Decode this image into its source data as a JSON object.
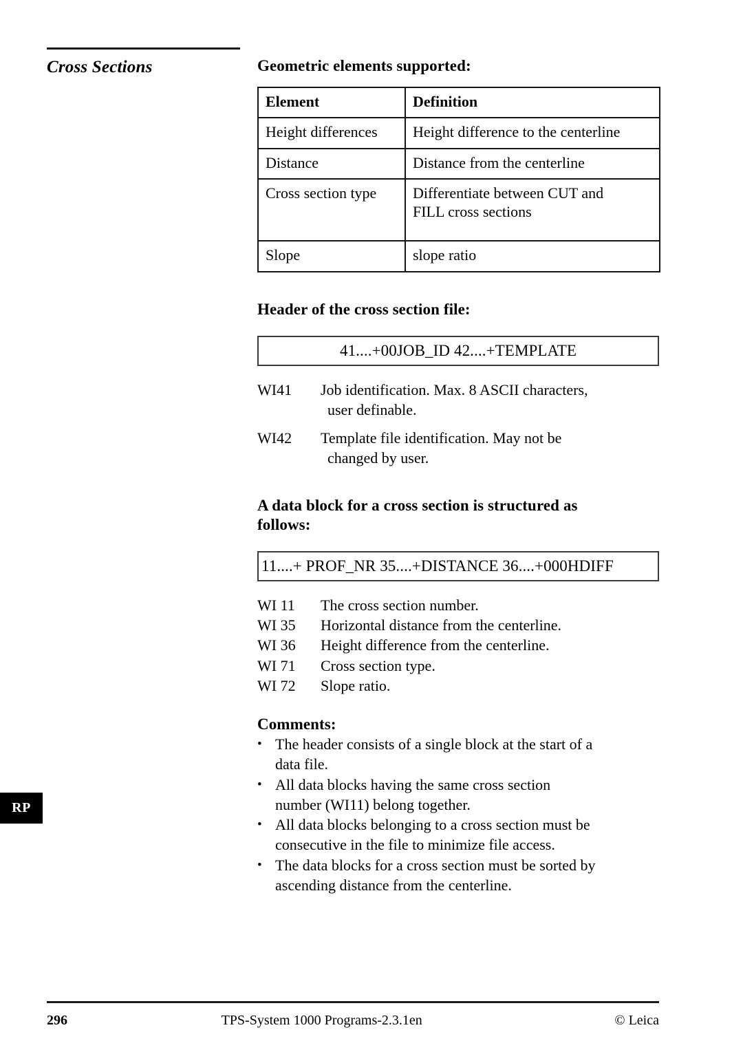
{
  "marginal": {
    "title": "Cross Sections",
    "thumb_tab": "RP"
  },
  "sections": {
    "geometric_heading": "Geometric elements supported:",
    "header_heading": "Header of the cross section file:",
    "datablock_heading_line1": "A data block for a cross section is structured as",
    "datablock_heading_line2": "follows:",
    "comments_heading": "Comments:"
  },
  "elements_table": {
    "columns": [
      "Element",
      "Definition"
    ],
    "rows": [
      {
        "element": "Height differences",
        "definition": "Height difference to the centerline",
        "definition_line2": ""
      },
      {
        "element": "Distance",
        "definition": "Distance from the centerline",
        "definition_line2": ""
      },
      {
        "element": "Cross section type",
        "definition": "Differentiate between CUT and",
        "definition_line2": "FILL cross sections"
      },
      {
        "element": "Slope",
        "definition": "slope ratio",
        "definition_line2": ""
      }
    ]
  },
  "header_block": {
    "code": "41....+00JOB_ID 42....+TEMPLATE",
    "definitions": [
      {
        "key": "WI41",
        "desc": "Job identification. Max. 8 ASCII characters,",
        "desc_cont": "user definable."
      },
      {
        "key": "WI42",
        "desc": "Template file identification. May not be",
        "desc_cont": "changed by user."
      }
    ]
  },
  "data_block": {
    "code": "11....+ PROF_NR 35....+DISTANCE 36....+000HDIFF",
    "definitions": [
      {
        "key": "WI 11",
        "desc": "The cross section number."
      },
      {
        "key": "WI 35",
        "desc": "Horizontal distance from the centerline."
      },
      {
        "key": "WI 36",
        "desc": "Height difference from the centerline."
      },
      {
        "key": "WI 71",
        "desc": "Cross section type."
      },
      {
        "key": "WI 72",
        "desc": "Slope ratio."
      }
    ]
  },
  "comments": {
    "bullet_mark": "•",
    "items": [
      {
        "line1": "The header consists of a single block at the start of a",
        "line2": "data file."
      },
      {
        "line1": "All data blocks having the same cross section",
        "line2": "number (WI11) belong together."
      },
      {
        "line1": "All data blocks belonging to a cross section must be",
        "line2": "consecutive in the file to minimize file access."
      },
      {
        "line1": "The data blocks for a cross section must be sorted by",
        "line2": "ascending distance from the centerline."
      }
    ]
  },
  "footer": {
    "page_number": "296",
    "document_title": "TPS-System 1000 Programs-2.3.1en",
    "copyright": "© Leica"
  }
}
